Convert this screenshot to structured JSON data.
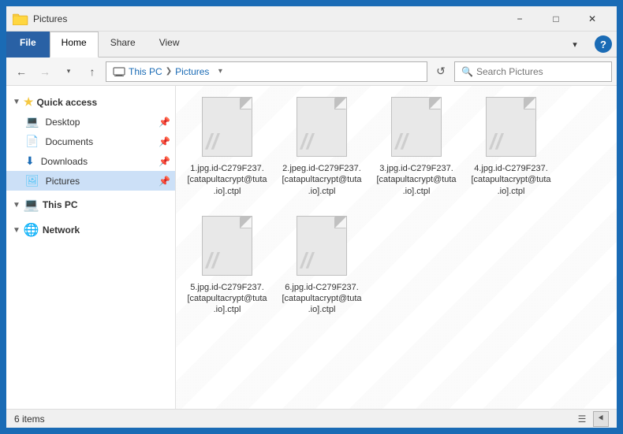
{
  "window": {
    "title": "Pictures",
    "titlebar_icon": "folder-icon"
  },
  "ribbon": {
    "tabs": [
      "File",
      "Home",
      "Share",
      "View"
    ],
    "active_tab": "Home"
  },
  "addressbar": {
    "back_enabled": true,
    "forward_disabled": true,
    "up_disabled": false,
    "breadcrumb": [
      "This PC",
      "Pictures"
    ],
    "search_placeholder": "Search Pictures",
    "refresh_label": "↻"
  },
  "sidebar": {
    "quick_access_label": "Quick access",
    "items": [
      {
        "id": "desktop",
        "label": "Desktop",
        "icon": "desktop-icon",
        "pinned": true
      },
      {
        "id": "documents",
        "label": "Documents",
        "icon": "docs-icon",
        "pinned": true
      },
      {
        "id": "downloads",
        "label": "Downloads",
        "icon": "downloads-icon",
        "pinned": true
      },
      {
        "id": "pictures",
        "label": "Pictures",
        "icon": "pictures-icon",
        "pinned": true,
        "active": true
      }
    ],
    "thispc_label": "This PC",
    "network_label": "Network"
  },
  "files": [
    {
      "name": "1.jpg.id-C279F237.[catapultacrypt@tuta.io].ctpl"
    },
    {
      "name": "2.jpeg.id-C279F237.[catapultacrypt@tuta.io].ctpl"
    },
    {
      "name": "3.jpg.id-C279F237.[catapultacrypt@tuta.io].ctpl"
    },
    {
      "name": "4.jpg.id-C279F237.[catapultacrypt@tuta.io].ctpl"
    },
    {
      "name": "5.jpg.id-C279F237.[catapultacrypt@tuta.io].ctpl"
    },
    {
      "name": "6.jpg.id-C279F237.[catapultacrypt@tuta.io].ctpl"
    }
  ],
  "statusbar": {
    "item_count": "6 items"
  }
}
